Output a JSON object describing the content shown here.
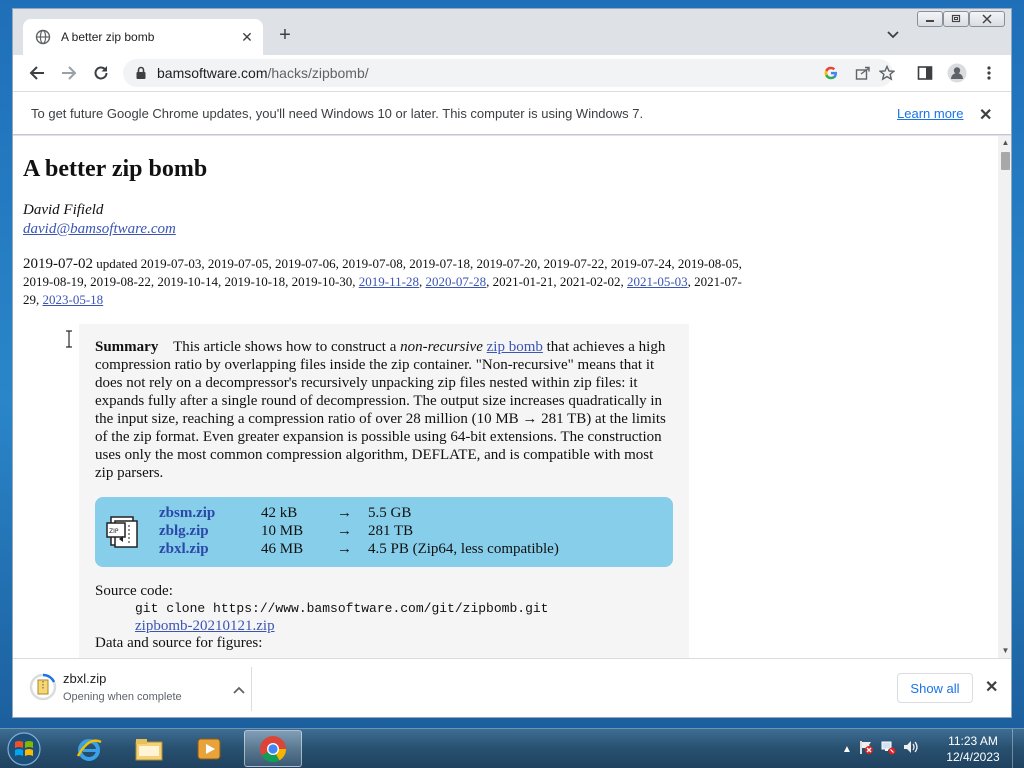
{
  "browser": {
    "tab_title": "A better zip bomb",
    "url_host": "bamsoftware.com",
    "url_path": "/hacks/zipbomb/"
  },
  "infobar": {
    "message": "To get future Google Chrome updates, you'll need Windows 10 or later. This computer is using Windows 7.",
    "link": "Learn more"
  },
  "page": {
    "title": "A better zip bomb",
    "author": "David Fifield",
    "email": "david@bamsoftware.com",
    "published": "2019-07-02",
    "updated_label": "updated",
    "updates_a": "2019-07-03, 2019-07-05, 2019-07-06, 2019-07-08, 2019-07-18, 2019-07-20, 2019-07-22, 2019-07-24, 2019-08-05, 2019-08-19, 2019-08-22, 2019-10-14, 2019-10-18, 2019-10-30,",
    "update_link_1": "2019-11-28",
    "update_link_2": "2020-07-28",
    "updates_b": ", 2021-01-21, 2021-02-02,",
    "update_link_3": "2021-05-03",
    "updates_c": ", 2021-07-29,",
    "update_link_4": "2023-05-18",
    "summary_heading": "Summary",
    "summary_p1": "This article shows how to construct a",
    "summary_em": "non-recursive",
    "summary_link": "zip bomb",
    "summary_p2": "that achieves a high compression ratio by overlapping files inside the zip container. \"Non-recursive\" means that it does not rely on a decompressor's recursively unpacking zip files nested within zip files: it expands fully after a single round of decompression. The output size increases quadratically in the input size, reaching a compression ratio of over 28 million (10 MB → 281 TB) at the limits of the zip format. Even greater expansion is possible using 64-bit extensions. The construction uses only the most common compression algorithm, DEFLATE, and is compatible with most zip parsers.",
    "downloads": [
      {
        "name": "zbsm.zip",
        "size": "42 kB",
        "arrow": "→",
        "result": "5.5 GB"
      },
      {
        "name": "zblg.zip",
        "size": "10 MB",
        "arrow": "→",
        "result": "281 TB"
      },
      {
        "name": "zbxl.zip",
        "size": "46 MB",
        "arrow": "→",
        "result": "4.5 PB (Zip64, less compatible)"
      }
    ],
    "source_label": "Source code:",
    "git_command": "git clone https://www.bamsoftware.com/git/zipbomb.git",
    "source_zip": "zipbomb-20210121.zip",
    "data_label": "Data and source for figures:"
  },
  "download_shelf": {
    "file_name": "zbxl.zip",
    "status": "Opening when complete",
    "show_all": "Show all"
  },
  "taskbar": {
    "time": "11:23 AM",
    "date": "12/4/2023"
  },
  "colors": {
    "link": "#3a55b5",
    "download_panel": "#87ceeb",
    "summary_bg": "#f5f5f5",
    "chrome_accent": "#1a73e8"
  }
}
